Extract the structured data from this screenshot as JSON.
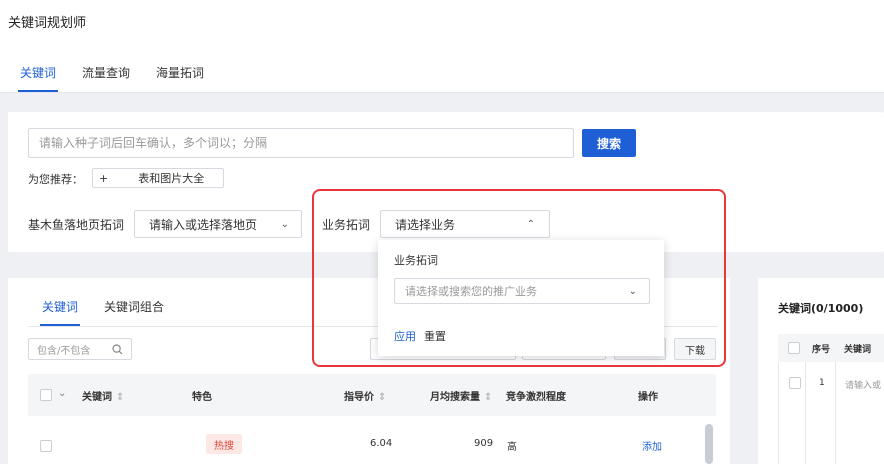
{
  "app": {
    "title": "关键词规划师"
  },
  "tabs": [
    {
      "label": "关键词",
      "active": true
    },
    {
      "label": "流量查询",
      "active": false
    },
    {
      "label": "海量拓词",
      "active": false
    }
  ],
  "search": {
    "placeholder": "请输入种子词后回车确认，多个词以；分隔",
    "button_label": "搜索",
    "recommend_label": "为您推荐：",
    "recommend_tag_plus": "+",
    "recommend_tag_text": "表和图片大全"
  },
  "landing_page": {
    "label": "基木鱼落地页拓词",
    "select_value": "请输入或选择落地页"
  },
  "business": {
    "label": "业务拓词",
    "select_value": "请选择业务"
  },
  "dropdown": {
    "title": "业务拓词",
    "select_placeholder": "请选择或搜索您的推广业务",
    "apply_label": "应用",
    "reset_label": "重置"
  },
  "list": {
    "tabs": [
      {
        "label": "关键词",
        "active": true
      },
      {
        "label": "关键词组合",
        "active": false
      }
    ],
    "filter_placeholder": "包含/不包含",
    "download_label": "下载",
    "columns": [
      "关键词",
      "特色",
      "指导价",
      "月均搜索量",
      "竞争激烈程度",
      "操作"
    ],
    "rows": [
      {
        "keyword": "",
        "feature": "热搜",
        "price": "6.04",
        "monthly": "909",
        "competition": "高",
        "action": "添加"
      }
    ]
  },
  "side": {
    "title": "关键词(0/1000)",
    "columns": [
      "序号",
      "关键词"
    ],
    "row": {
      "index": "1",
      "placeholder": "请输入或"
    }
  },
  "colors": {
    "accent": "#1f5fd6",
    "highlight": "#e8373a",
    "hot_badge_bg": "#fde8e6",
    "hot_badge_text": "#e0473a"
  }
}
